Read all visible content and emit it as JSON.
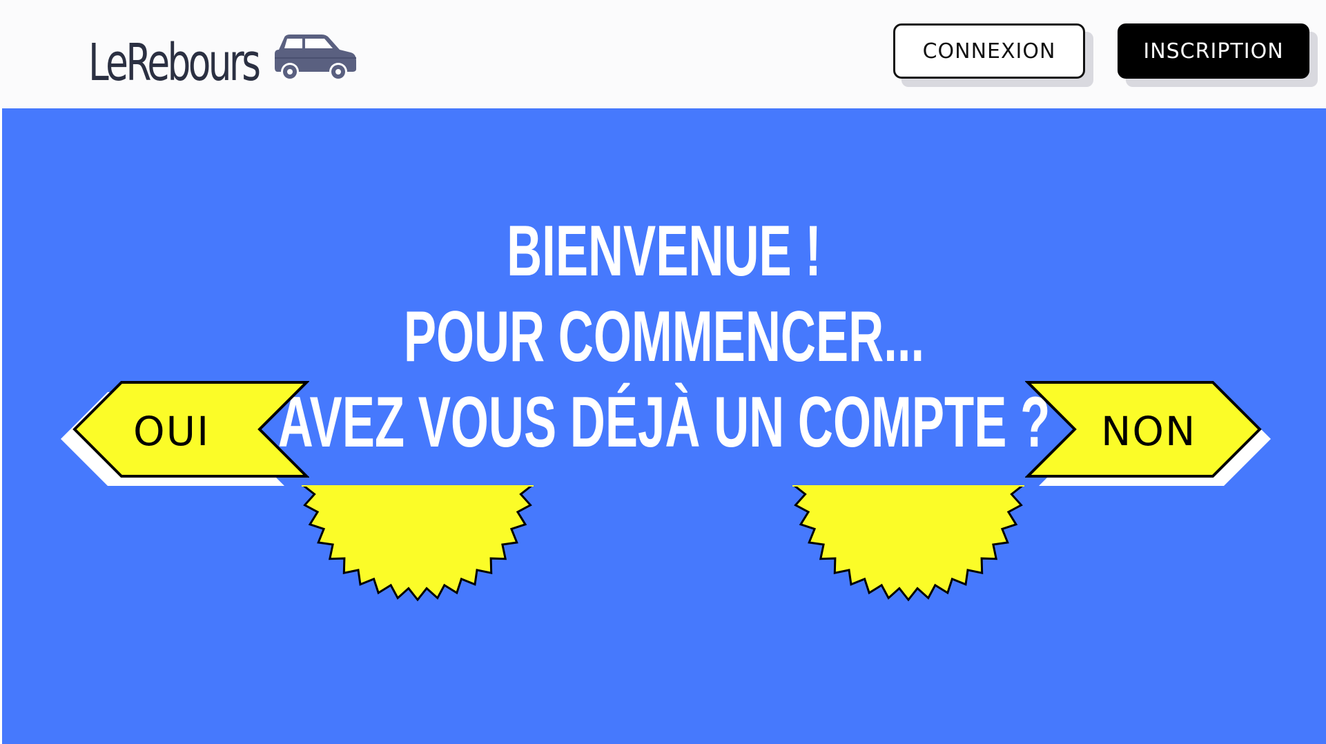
{
  "header": {
    "logo_text": "LeRebours",
    "login_label": "CONNEXION",
    "signup_label": "INSCRIPTION"
  },
  "hero": {
    "line1": "BIENVENUE !",
    "line2": "POUR COMMENCER...",
    "line3": "AVEZ VOUS DÉJÀ UN COMPTE ?",
    "yes_label": "OUI",
    "no_label": "NON"
  },
  "colors": {
    "hero_background": "#4679fd",
    "accent_yellow": "#fbfc28",
    "header_background": "#fbfbfc",
    "logo_text": "#2b3042",
    "car": "#5a6080"
  },
  "icons": {
    "logo": "car-icon",
    "left_arrow": "arrow-left-icon",
    "right_arrow": "arrow-right-icon",
    "seal": "starburst-seal"
  }
}
